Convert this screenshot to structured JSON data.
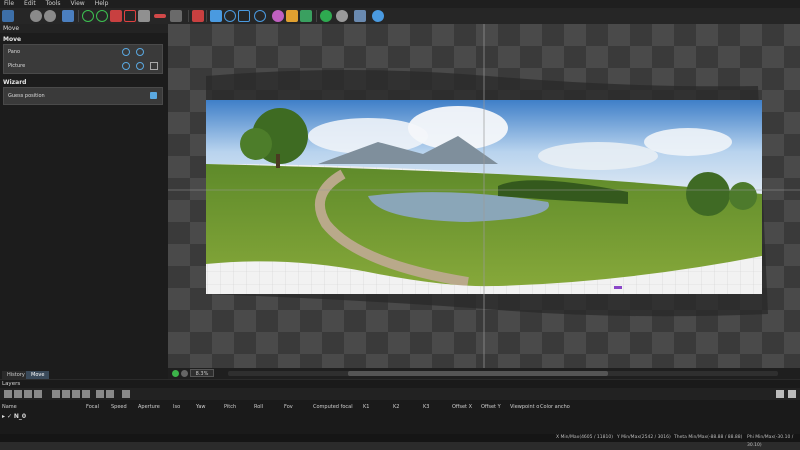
{
  "menu": {
    "file": "File",
    "edit": "Edit",
    "tools": "Tools",
    "view": "View",
    "help": "Help"
  },
  "left_panel": {
    "title": "Move",
    "move_section": "Move",
    "pano_label": "Pano",
    "picture_label": "Picture",
    "wizard_section": "Wizard",
    "guess_label": "Guess position"
  },
  "tabs": {
    "history": "History",
    "move": "Move"
  },
  "zoom": {
    "value": "8.3%"
  },
  "layers": {
    "title": "Layers",
    "columns": [
      "Name",
      "Focal",
      "Speed",
      "Aperture",
      "Iso",
      "Yaw",
      "Pitch",
      "Roll",
      "Fov",
      "Computed focal",
      "K1",
      "K2",
      "K3",
      "Offset X",
      "Offset Y",
      "Viewpoint o",
      "Color ancho"
    ],
    "row_name": "N_0"
  },
  "status": {
    "x": "X Min/Max(4605 / 11810)",
    "y": "Y Min/Max(2542 / 3016)",
    "theta": "Theta Min/Max(-88.88 / 88.88)",
    "phi": "Phi Min/Max(-30.10 / 30.10)"
  },
  "colors": {
    "accent": "#5aa8e0",
    "panel": "#1c1c1c",
    "selected": "#3a3a3a"
  }
}
